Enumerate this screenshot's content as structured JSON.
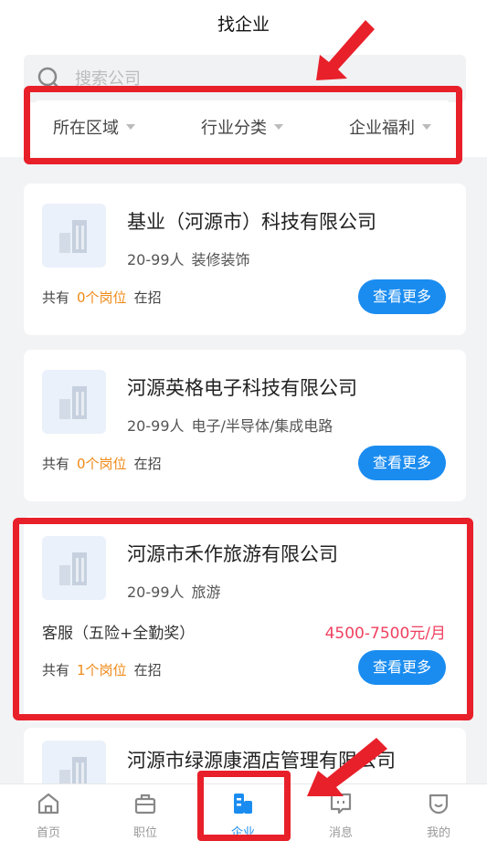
{
  "header": {
    "title": "找企业"
  },
  "search": {
    "placeholder": "搜索公司"
  },
  "filters": [
    {
      "label": "所在区域"
    },
    {
      "label": "行业分类"
    },
    {
      "label": "企业福利"
    }
  ],
  "companies": [
    {
      "name": "基业（河源市）科技有限公司",
      "size": "20-99人",
      "industry": "装修装饰",
      "pos_prefix": "共有",
      "pos_count": "0个岗位",
      "pos_suffix": "在招",
      "button": "查看更多"
    },
    {
      "name": "河源英格电子科技有限公司",
      "size": "20-99人",
      "industry": "电子/半导体/集成电路",
      "pos_prefix": "共有",
      "pos_count": "0个岗位",
      "pos_suffix": "在招",
      "button": "查看更多"
    },
    {
      "name": "河源市禾作旅游有限公司",
      "size": "20-99人",
      "industry": "旅游",
      "job": {
        "title": "客服（五险+全勤奖）",
        "salary": "4500-7500元/月"
      },
      "pos_prefix": "共有",
      "pos_count": "1个岗位",
      "pos_suffix": "在招",
      "button": "查看更多"
    },
    {
      "name": "河源市绿源康酒店管理有限公司"
    }
  ],
  "tabbar": [
    {
      "label": "首页",
      "icon": "home-icon"
    },
    {
      "label": "职位",
      "icon": "briefcase-icon"
    },
    {
      "label": "企业",
      "icon": "company-icon",
      "active": true
    },
    {
      "label": "消息",
      "icon": "message-icon"
    },
    {
      "label": "我的",
      "icon": "profile-icon"
    }
  ],
  "colors": {
    "accent": "#1a8cf0",
    "highlight": "#e8202a",
    "salary": "#f04060",
    "count": "#f08a18"
  }
}
